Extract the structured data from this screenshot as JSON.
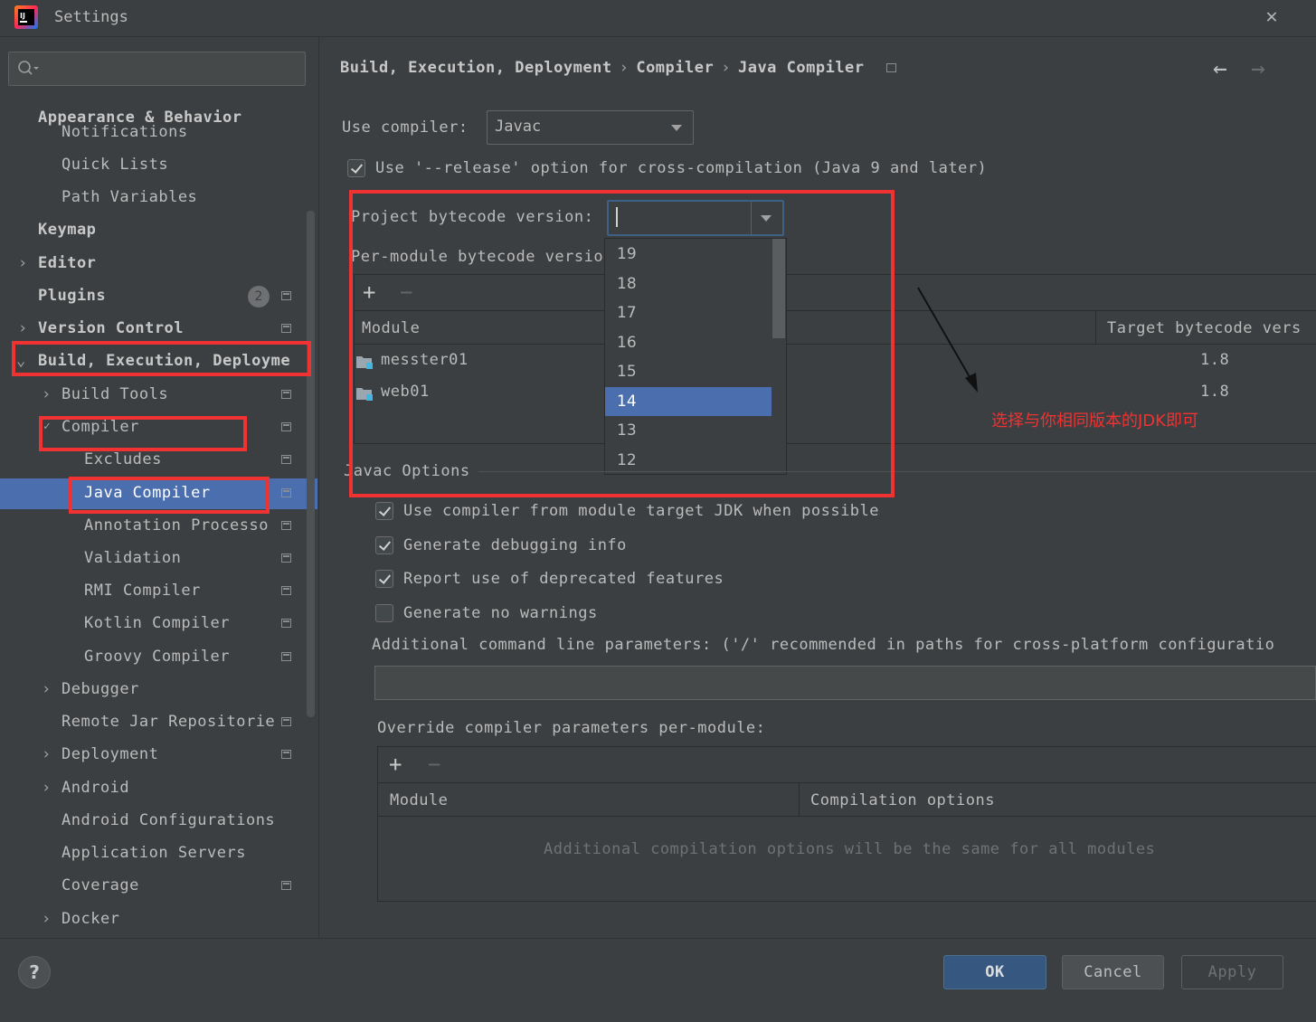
{
  "window": {
    "title": "Settings"
  },
  "search": {
    "placeholder": ""
  },
  "sidebar": {
    "items": [
      {
        "label": "Appearance & Behavior"
      },
      {
        "label": "Notifications"
      },
      {
        "label": "Quick Lists"
      },
      {
        "label": "Path Variables"
      },
      {
        "label": "Keymap"
      },
      {
        "label": "Editor"
      },
      {
        "label": "Plugins",
        "badge": "2"
      },
      {
        "label": "Version Control"
      },
      {
        "label": "Build, Execution, Deployme"
      },
      {
        "label": "Build Tools"
      },
      {
        "label": "Compiler"
      },
      {
        "label": "Excludes"
      },
      {
        "label": "Java Compiler"
      },
      {
        "label": "Annotation Processo"
      },
      {
        "label": "Validation"
      },
      {
        "label": "RMI Compiler"
      },
      {
        "label": "Kotlin Compiler"
      },
      {
        "label": "Groovy Compiler"
      },
      {
        "label": "Debugger"
      },
      {
        "label": "Remote Jar Repositorie"
      },
      {
        "label": "Deployment"
      },
      {
        "label": "Android"
      },
      {
        "label": "Android Configurations"
      },
      {
        "label": "Application Servers"
      },
      {
        "label": "Coverage"
      },
      {
        "label": "Docker"
      }
    ]
  },
  "breadcrumb": {
    "part1": "Build, Execution, Deployment",
    "sep": "›",
    "part2": "Compiler",
    "part3": "Java Compiler"
  },
  "form": {
    "use_compiler_label": "Use compiler:",
    "use_compiler_value": "Javac",
    "release_option_label": "Use '--release' option for cross-compilation (Java 9 and later)",
    "release_option_checked": true,
    "project_bytecode_label": "Project bytecode version:",
    "project_bytecode_value": "",
    "per_module_label": "Per-module bytecode versio",
    "per_module_table": {
      "col_module": "Module",
      "col_target": "Target bytecode vers",
      "rows": [
        {
          "module": "messter01",
          "target": "1.8"
        },
        {
          "module": "web01",
          "target": "1.8"
        }
      ]
    },
    "bytecode_options": [
      "19",
      "18",
      "17",
      "16",
      "15",
      "14",
      "13",
      "12"
    ],
    "bytecode_selected": "14",
    "javac_options_title": "Javac Options",
    "checks": [
      {
        "label": "Use compiler from module target JDK when possible",
        "checked": true
      },
      {
        "label": "Generate debugging info",
        "checked": true
      },
      {
        "label": "Report use of deprecated features",
        "checked": true
      },
      {
        "label": "Generate no warnings",
        "checked": false
      }
    ],
    "additional_params_label": "Additional command line parameters:  ('/' recommended in paths for cross-platform configuratio",
    "additional_params_value": "",
    "override_label": "Override compiler parameters per-module:",
    "override_table": {
      "col_module": "Module",
      "col_options": "Compilation options",
      "empty_text": "Additional compilation options will be the same for all modules"
    }
  },
  "annotation": {
    "text": "选择与你相同版本的JDK即可"
  },
  "buttons": {
    "ok": "OK",
    "cancel": "Cancel",
    "apply": "Apply",
    "help": "?"
  },
  "colors": {
    "selection": "#4b6eaf",
    "annotation_red": "#f03232",
    "ok_button": "#365880"
  }
}
